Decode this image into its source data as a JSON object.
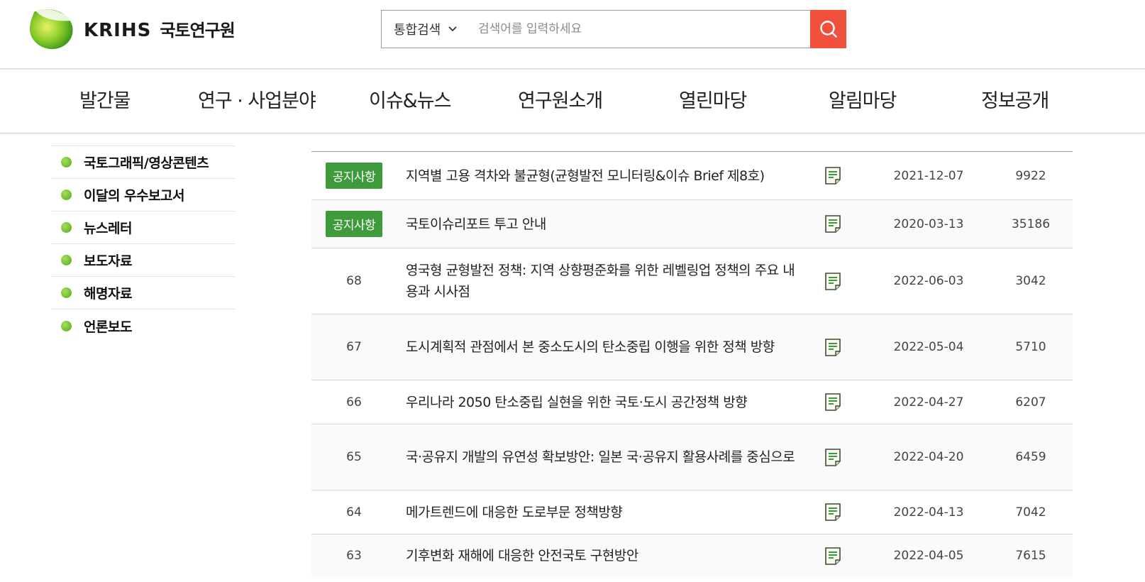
{
  "header": {
    "logo_en": "KRIHS",
    "logo_ko": "국토연구원",
    "search_scope": "통합검색",
    "search_placeholder": "검색어를 입력하세요"
  },
  "nav": {
    "items": [
      "발간물",
      "연구 · 사업분야",
      "이슈&뉴스",
      "연구원소개",
      "열린마당",
      "알림마당",
      "정보공개"
    ]
  },
  "sidebar": {
    "items": [
      "국토그래픽/영상콘텐츠",
      "이달의 우수보고서",
      "뉴스레터",
      "보도자료",
      "해명자료",
      "언론보도"
    ]
  },
  "board": {
    "rows": [
      {
        "no": "공지사항",
        "notice": true,
        "title": "지역별 고용 격차와 불균형(균형발전 모니터링&이슈 Brief 제8호)",
        "date": "2021-12-07",
        "views": "9922"
      },
      {
        "no": "공지사항",
        "notice": true,
        "title": "국토이슈리포트 투고 안내",
        "date": "2020-03-13",
        "views": "35186"
      },
      {
        "no": "68",
        "notice": false,
        "title": "영국형 균형발전 정책: 지역 상향평준화를 위한 레벨링업 정책의 주요 내용과 시사점",
        "date": "2022-06-03",
        "views": "3042"
      },
      {
        "no": "67",
        "notice": false,
        "title": "도시계획적 관점에서 본 중소도시의 탄소중립 이행을 위한 정책 방향",
        "date": "2022-05-04",
        "views": "5710"
      },
      {
        "no": "66",
        "notice": false,
        "title": "우리나라 2050 탄소중립 실현을 위한 국토·도시 공간정책 방향",
        "date": "2022-04-27",
        "views": "6207"
      },
      {
        "no": "65",
        "notice": false,
        "title": "국·공유지 개발의 유연성 확보방안: 일본 국·공유지 활용사례를 중심으로",
        "date": "2022-04-20",
        "views": "6459"
      },
      {
        "no": "64",
        "notice": false,
        "title": "메가트렌드에 대응한 도로부문 정책방향",
        "date": "2022-04-13",
        "views": "7042"
      },
      {
        "no": "63",
        "notice": false,
        "title": "기후변화 재해에 대응한 안전국토 구현방안",
        "date": "2022-04-05",
        "views": "7615"
      }
    ]
  },
  "colors": {
    "accent_search": "#f0503c",
    "notice_badge": "#3e9a3a",
    "bullet": "#6cc027"
  },
  "icons": {
    "search": "search-icon",
    "file": "document-icon",
    "scope": "chevron-down-icon"
  }
}
